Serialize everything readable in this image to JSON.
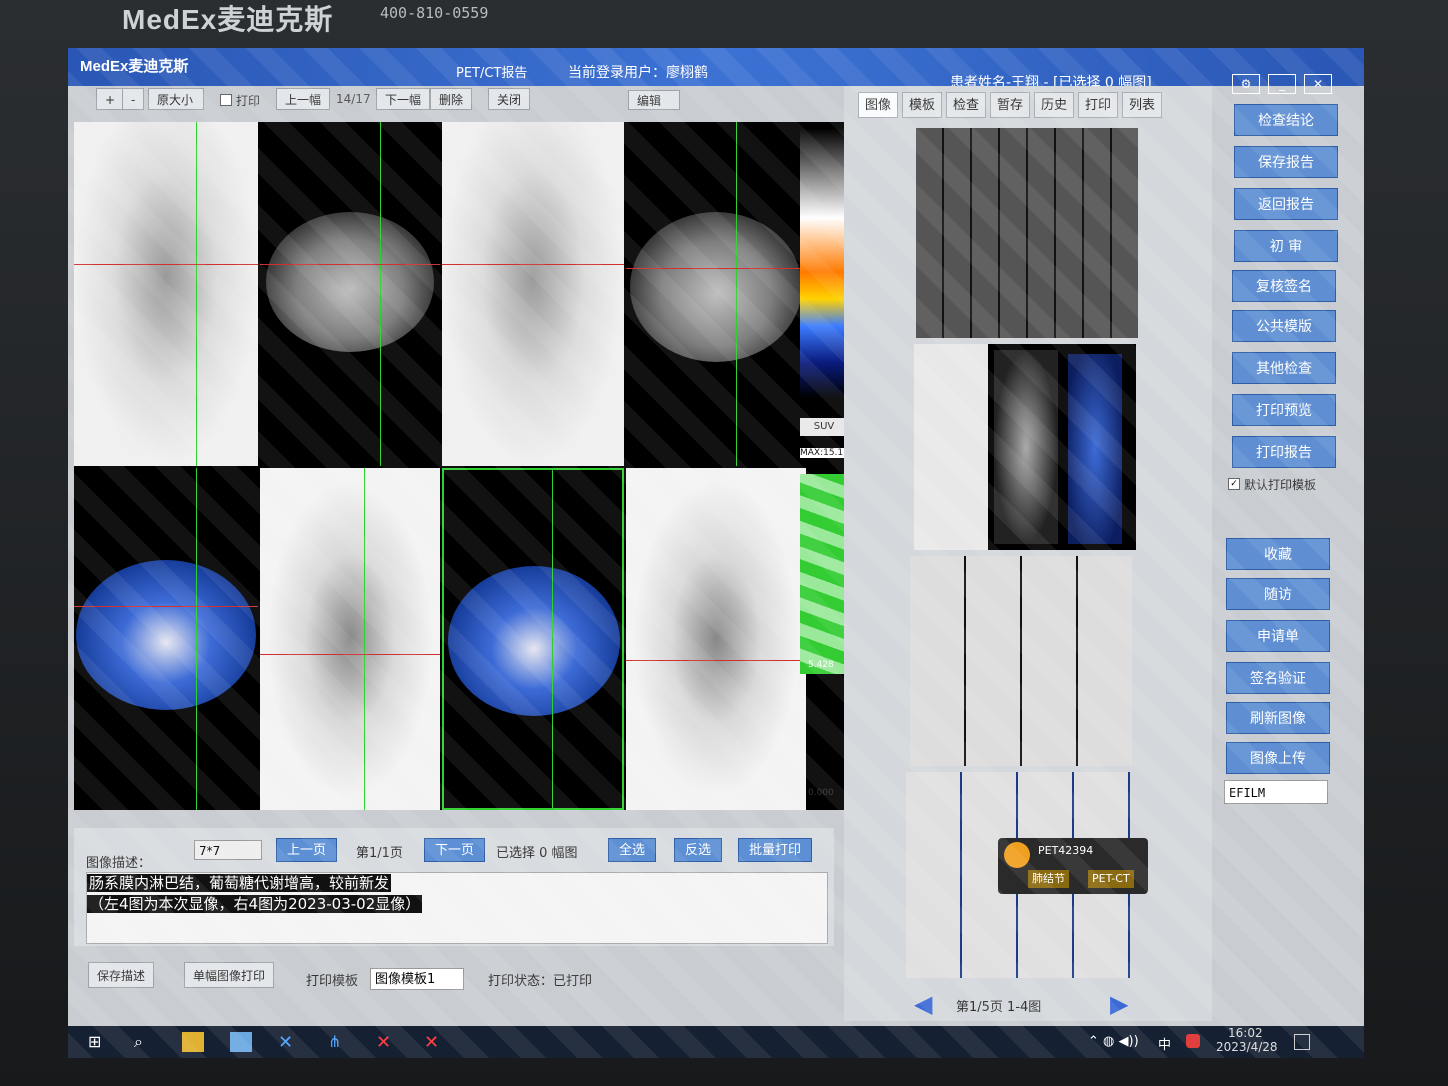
{
  "monitor": {
    "brand": "MedEx麦迪克斯",
    "phone": "400-810-0559"
  },
  "titlebar": {
    "app_logo": "MedEx麦迪克斯",
    "report_title": "PET/CT报告",
    "current_user": "当前登录用户：廖栩鹤",
    "patient_info": "患者姓名-王翔 - [已选择 0 幅图]"
  },
  "toolbar": {
    "zoom_in": "+",
    "zoom_out": "-",
    "original_size": "原大小",
    "print": "打印",
    "prev": "上一幅",
    "page": "14/17",
    "next": "下一幅",
    "delete": "删除",
    "close": "关闭",
    "edit": "编辑"
  },
  "colorbar": {
    "unit": "SUV",
    "max": "MAX:15.11",
    "mid": "5.428",
    "min": "0.000"
  },
  "image_panel": {
    "layout_select": "7*7",
    "prev_page": "上一页",
    "page_info": "第1/1页",
    "next_page": "下一页",
    "selected": "已选择 0 幅图",
    "select_all": "全选",
    "invert": "反选",
    "batch_print": "批量打印",
    "desc_label": "图像描述：",
    "desc_line1": "肠系膜内淋巴结，葡萄糖代谢增高，较前新发",
    "desc_line2": "（左4图为本次显像，右4图为2023-03-02显像）",
    "save_desc": "保存描述",
    "single_print": "单幅图像打印",
    "print_template_label": "打印模板",
    "print_template_value": "图像模板1",
    "print_status": "打印状态：已打印"
  },
  "tabs": [
    "图像",
    "模板",
    "检查",
    "暂存",
    "历史",
    "打印",
    "列表"
  ],
  "thumbs": {
    "pagination": "第1/5页 1-4图",
    "popup_title": "PET42394",
    "popup_btn1": "肺结节",
    "popup_btn2": "PET-CT"
  },
  "side_buttons": [
    "检查结论",
    "保存报告",
    "返回报告",
    "初 审",
    "复核签名",
    "公共模版",
    "其他检查",
    "打印预览",
    "打印报告"
  ],
  "default_print_template": "默认打印模板",
  "side_buttons2": [
    "收藏",
    "随访",
    "申请单",
    "签名验证",
    "刷新图像",
    "图像上传"
  ],
  "efilm_select": "EFILM",
  "taskbar": {
    "time": "16:02",
    "date": "2023/4/28",
    "ime": "中"
  },
  "colors": {
    "accent": "#3c72d4",
    "button": "#5f8fd2",
    "cross_green": "#2ed02e",
    "cross_red": "#d03030"
  }
}
